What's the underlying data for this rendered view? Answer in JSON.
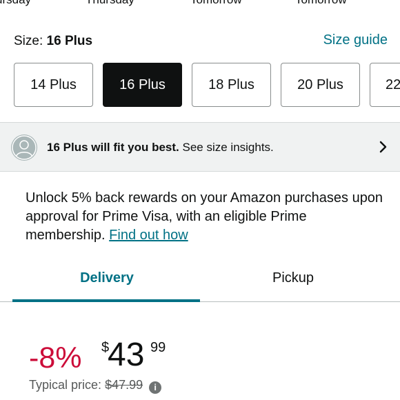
{
  "delivery_options": [
    {
      "day_label": "ursday"
    },
    {
      "day_label": "Thursday"
    },
    {
      "day_label": "Tomorrow"
    },
    {
      "day_label": "Tomorrow"
    }
  ],
  "size": {
    "label": "Size:",
    "selected": "16 Plus",
    "guide_link": "Size guide",
    "options": [
      "14 Plus",
      "16 Plus",
      "18 Plus",
      "20 Plus",
      "22"
    ]
  },
  "insight": {
    "avatar_icon": "user-avatar-icon",
    "bold_text": "16 Plus will fit you best.",
    "text": " See size insights.",
    "chevron_icon": "chevron-right-icon"
  },
  "promo": {
    "text": "Unlock 5% back rewards on your Amazon purchases upon approval for Prime Visa, with an eligible Prime membership.",
    "link": "Find out how"
  },
  "fulfillment_tabs": {
    "delivery": "Delivery",
    "pickup": "Pickup",
    "active": "Delivery"
  },
  "price": {
    "discount": "-8%",
    "currency": "$",
    "whole": "43",
    "fraction": "99",
    "typical_label": "Typical price:",
    "typical_value": "$47.99",
    "info_icon": "info-icon"
  },
  "colors": {
    "link": "#007185",
    "discount": "#cc0c39",
    "selected_button": "#0f1111"
  }
}
